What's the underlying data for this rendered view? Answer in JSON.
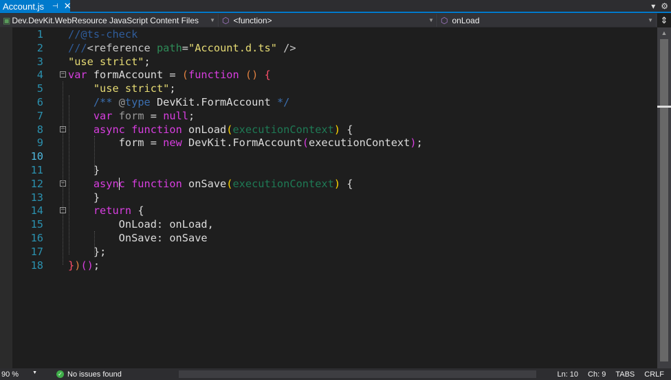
{
  "tab": {
    "title": "Account.js",
    "pin_icon": "pin-icon",
    "close_icon": "close-icon"
  },
  "nav": {
    "project": "Dev.DevKit.WebResource JavaScript Content Files",
    "scope": "<function>",
    "member": "onLoad"
  },
  "editor": {
    "line_numbers": [
      "1",
      "2",
      "3",
      "4",
      "5",
      "6",
      "7",
      "8",
      "9",
      "10",
      "11",
      "12",
      "13",
      "14",
      "15",
      "16",
      "17",
      "18"
    ],
    "active_line": 10,
    "lines": [
      [
        [
          "//",
          "t-com"
        ],
        [
          "@ts-check",
          "t-com"
        ]
      ],
      [
        [
          "///",
          "t-com"
        ],
        [
          "<reference ",
          "t-tag"
        ],
        [
          "path",
          "t-attr"
        ],
        [
          "=",
          "t-txt"
        ],
        [
          "\"Account.d.ts\"",
          "t-str"
        ],
        [
          " />",
          "t-tag"
        ]
      ],
      [
        [
          "\"use strict\"",
          "t-str"
        ],
        [
          ";",
          "t-txt"
        ]
      ],
      [
        [
          "var",
          "t-kw"
        ],
        [
          " formAccount = ",
          "t-txt"
        ],
        [
          "(",
          "t-paren"
        ],
        [
          "function",
          "t-kw"
        ],
        [
          " ",
          "t-txt"
        ],
        [
          "()",
          "t-paren"
        ],
        [
          " ",
          "t-txt"
        ],
        [
          "{",
          "t-brace"
        ]
      ],
      [
        [
          "    ",
          "t-txt"
        ],
        [
          "\"use strict\"",
          "t-str"
        ],
        [
          ";",
          "t-txt"
        ]
      ],
      [
        [
          "    ",
          "t-txt"
        ],
        [
          "/** ",
          "t-com2"
        ],
        [
          "@",
          "t-dim"
        ],
        [
          "type",
          "t-com2"
        ],
        [
          " DevKit.FormAccount ",
          "t-txt"
        ],
        [
          "*/",
          "t-com2"
        ]
      ],
      [
        [
          "    ",
          "t-txt"
        ],
        [
          "var",
          "t-kw"
        ],
        [
          " ",
          "t-txt"
        ],
        [
          "form",
          "t-dim"
        ],
        [
          " = ",
          "t-txt"
        ],
        [
          "null",
          "t-kw"
        ],
        [
          ";",
          "t-txt"
        ]
      ],
      [
        [
          "    ",
          "t-txt"
        ],
        [
          "async function",
          "t-kw"
        ],
        [
          " onLoad",
          "t-txt"
        ],
        [
          "(",
          "t-yel"
        ],
        [
          "executionContext",
          "t-param"
        ],
        [
          ")",
          "t-yel"
        ],
        [
          " {",
          "t-txt"
        ]
      ],
      [
        [
          "        form = ",
          "t-txt"
        ],
        [
          "new",
          "t-kw"
        ],
        [
          " DevKit.FormAccount",
          "t-txt"
        ],
        [
          "(",
          "t-kw"
        ],
        [
          "executionContext",
          "t-txt"
        ],
        [
          ")",
          "t-kw"
        ],
        [
          ";",
          "t-txt"
        ]
      ],
      [
        [
          "",
          "t-txt"
        ]
      ],
      [
        [
          "    }",
          "t-txt"
        ]
      ],
      [
        [
          "    ",
          "t-txt"
        ],
        [
          "async function",
          "t-kw"
        ],
        [
          " onSave",
          "t-txt"
        ],
        [
          "(",
          "t-yel"
        ],
        [
          "executionContext",
          "t-param"
        ],
        [
          ")",
          "t-yel"
        ],
        [
          " {",
          "t-txt"
        ]
      ],
      [
        [
          "    }",
          "t-txt"
        ]
      ],
      [
        [
          "    ",
          "t-txt"
        ],
        [
          "return",
          "t-kw"
        ],
        [
          " {",
          "t-txt"
        ]
      ],
      [
        [
          "        OnLoad: onLoad,",
          "t-txt"
        ]
      ],
      [
        [
          "        OnSave: onSave",
          "t-txt"
        ]
      ],
      [
        [
          "    }",
          "t-txt"
        ],
        [
          ";",
          "t-txt"
        ]
      ],
      [
        [
          "}",
          "t-brace"
        ],
        [
          ")",
          "t-paren"
        ],
        [
          "()",
          "t-kw"
        ],
        [
          ";",
          "t-txt"
        ]
      ]
    ]
  },
  "status": {
    "zoom": "90 %",
    "issues": "No issues found",
    "ln": "Ln: 10",
    "ch": "Ch: 9",
    "indent": "TABS",
    "eol": "CRLF"
  }
}
